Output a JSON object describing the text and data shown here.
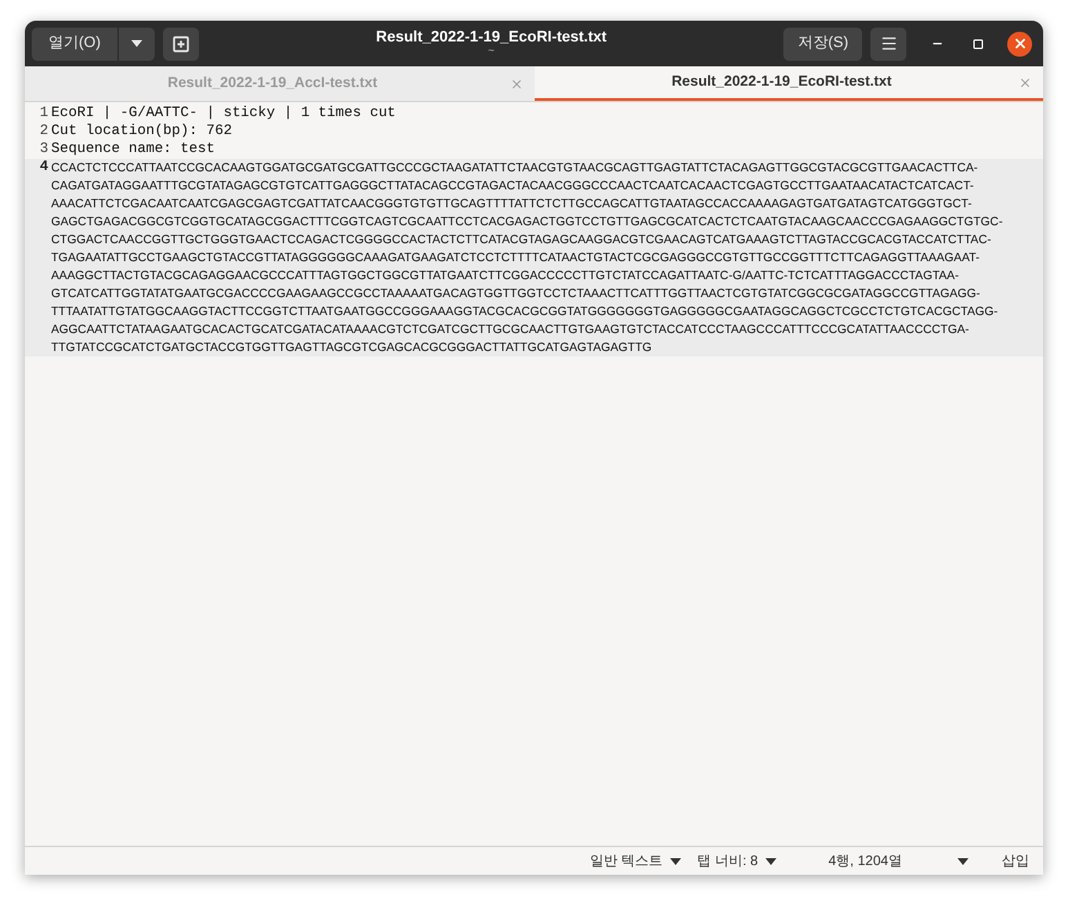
{
  "header": {
    "open_button": "열기(O)",
    "title": "Result_2022-1-19_EcoRI-test.txt",
    "subtitle": "~",
    "save_button": "저장(S)"
  },
  "tabs": [
    {
      "label": "Result_2022-1-19_AccI-test.txt",
      "selected": false
    },
    {
      "label": "Result_2022-1-19_EcoRI-test.txt",
      "selected": true
    }
  ],
  "lines": [
    {
      "number": "1",
      "current": false,
      "rows": [
        "EcoRI | -G/AATTC- | sticky | 1 times cut"
      ]
    },
    {
      "number": "2",
      "current": false,
      "rows": [
        "Cut location(bp): 762"
      ]
    },
    {
      "number": "3",
      "current": false,
      "rows": [
        "Sequence name: test"
      ]
    },
    {
      "number": "4",
      "current": true,
      "rows": [
        "CCACTCTCCCATTAATCCGCACAAGTGGATGCGATGCGATTGCCCGCTAAGATATTCTAACGTGTAACGCAGTTGAGTATTCTACAGAGTTGGCGTACGCGTTGAACACTTCA-",
        "CAGATGATAGGAATTTGCGTATAGAGCGTGTCATTGAGGGCTTATACAGCCGTAGACTACAACGGGCCCAACTCAATCACAACTCGAGTGCCTTGAATAACATACTCATCACT-",
        "AAACATTCTCGACAATCAATCGAGCGAGTCGATTATCAACGGGTGTGTTGCAGTTTTATTCTCTTGCCAGCATTGTAATAGCCACCAAAAGAGTGATGATAGTCATGGGTGCT-",
        "GAGCTGAGACGGCGTCGGTGCATAGCGGACTTTCGGTCAGTCGCAATTCCTCACGAGACTGGTCCTGTTGAGCGCATCACTCTCAATGTACAAGCAACCCGAGAAGGCTGTGC-",
        "CTGGACTCAACCGGTTGCTGGGTGAACTCCAGACTCGGGGCCACTACTCTTCATACGTAGAGCAAGGACGTCGAACAGTCATGAAAGTCTTAGTACCGCACGTACCATCTTAC-",
        "TGAGAATATTGCCTGAAGCTGTACCGTTATAGGGGGGCAAAGATGAAGATCTCCTCTTTTCATAACTGTACTCGCGAGGGCCGTGTTGCCGGTTTCTTCAGAGGTTAAAGAAT-",
        "AAAGGCTTACTGTACGCAGAGGAACGCCCATTTAGTGGCTGGCGTTATGAATCTTCGGACCCCCTTGTCTATCCAGATTAATC-G/AATTC-TCTCATTTAGGACCCTAGTAA-",
        "GTCATCATTGGTATATGAATGCGACCCCGAAGAAGCCGCCTAAAAATGACAGTGGTTGGTCCTCTAAACTTCATTTGGTTAACTCGTGTATCGGCGCGATAGGCCGTTAGAGG-",
        "TTTAATATTGTATGGCAAGGTACTTCCGGTCTTAATGAATGGCCGGGAAAGGTACGCACGCGGTATGGGGGGGTGAGGGGGCGAATAGGCAGGCTCGCCTCTGTCACGCTAGG-",
        "AGGCAATTCTATAAGAATGCACACTGCATCGATACATAAAACGTCTCGATCGCTTGCGCAACTTGTGAAGTGTCTACCATCCCTAAGCCCATTTCCCGCATATTAACCCCTGA-",
        "TTGTATCCGCATCTGATGCTACCGTGGTTGAGTTAGCGTCGAGCACGCGGGACTTATTGCATGAGTAGAGTTG"
      ]
    }
  ],
  "status_bar": {
    "syntax": "일반 텍스트",
    "tab_width": "탭 너비: 8",
    "position": "4행, 1204열",
    "mode": "삽입"
  }
}
